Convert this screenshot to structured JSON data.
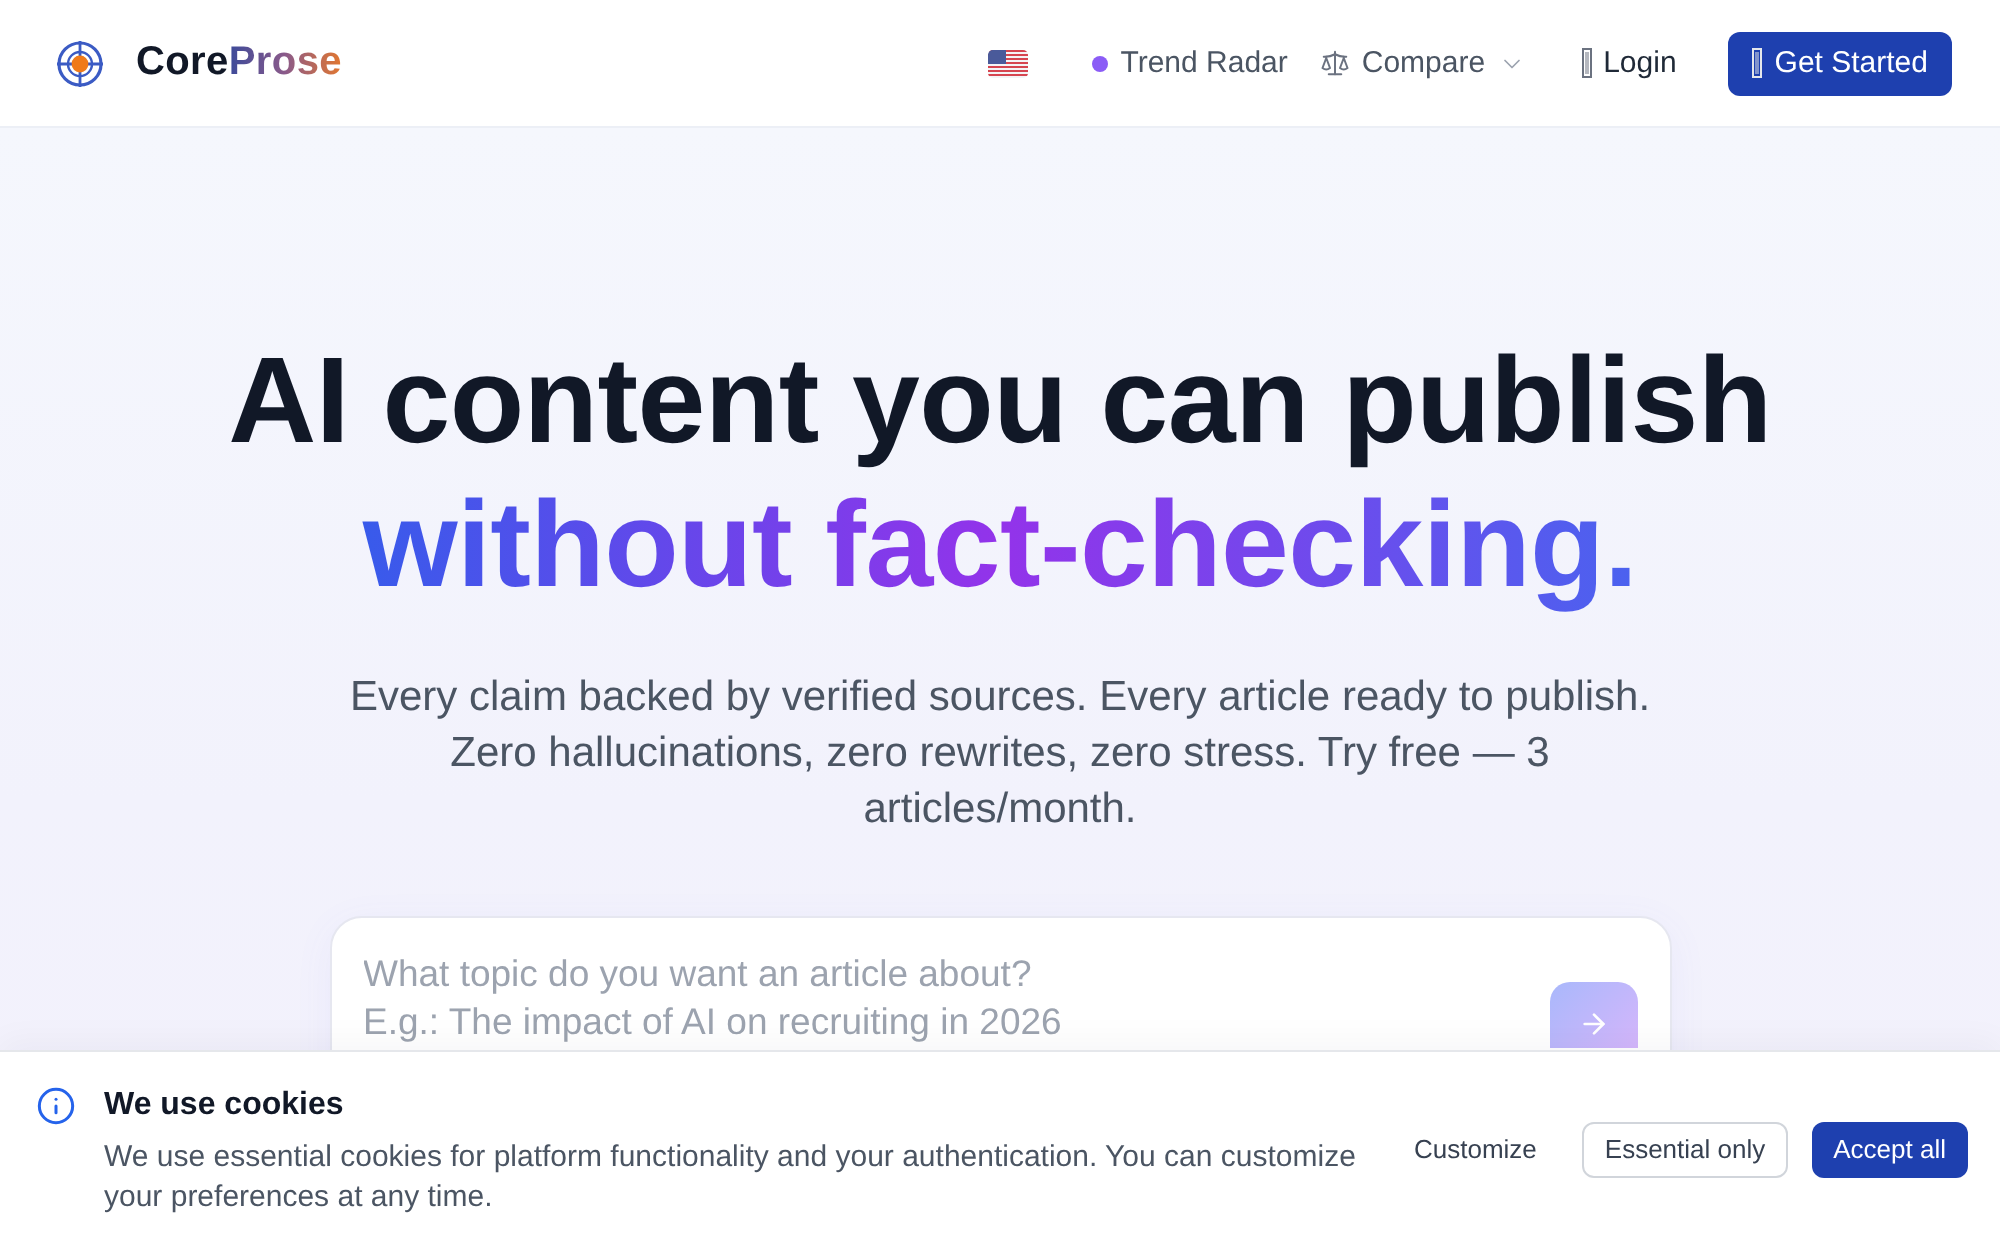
{
  "header": {
    "brand": {
      "main": "Core",
      "accent": "Prose"
    },
    "nav": [
      {
        "kind": "dot-link",
        "label": "Trend Radar"
      },
      {
        "kind": "dropdown",
        "label": "Compare"
      },
      {
        "kind": "icon-link",
        "label": "Login"
      }
    ],
    "cta": "Get Started"
  },
  "hero": {
    "headline": {
      "line_1": "AI content you can publish",
      "line_2": "without fact-checking."
    },
    "subtitle": "Every claim backed by verified sources. Every article ready to publish. Zero hallucinations, zero rewrites, zero stress. Try free — 3 articles/month.",
    "prompt": {
      "placeholder": "What topic do you want an article about?\nE.g.: The impact of AI on recruiting in 2026"
    }
  },
  "cookie_banner": {
    "title": "We use cookies",
    "text": "We use essential cookies for platform functionality and your authentication. You can customize your preferences at any time.",
    "buttons": [
      {
        "kind": "text",
        "label": "Customize"
      },
      {
        "kind": "outline",
        "label": "Essential only"
      },
      {
        "kind": "primary",
        "label": "Accept all"
      }
    ]
  }
}
